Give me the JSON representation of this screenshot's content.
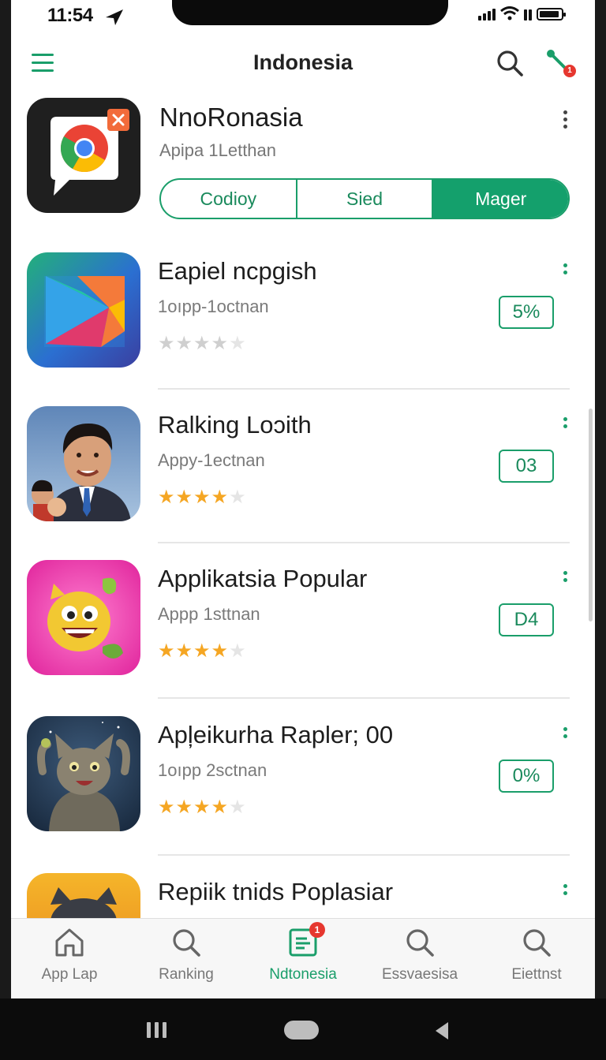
{
  "status_bar": {
    "time": "11:54"
  },
  "header": {
    "title": "Indonesia",
    "notification_count": "1"
  },
  "featured": {
    "name": "NnoRonasia",
    "subtitle": "Apipa 1Letthan",
    "segments": [
      "Codioy",
      "Sied",
      "Mager"
    ],
    "selected_segment": "Mager"
  },
  "apps": [
    {
      "name": "Eapiel ncpgish",
      "subtitle": "1oıpp-1octnan",
      "rating": 0,
      "badge": "5%",
      "icon": "play-store-icon"
    },
    {
      "name": "Ralking Loɔith",
      "subtitle": "Appy-1ectnan",
      "rating": 4,
      "badge": "03",
      "icon": "man-portrait-icon"
    },
    {
      "name": "Applikatsia Popular",
      "subtitle": "Appp 1sttnan",
      "rating": 4,
      "badge": "D4",
      "icon": "emoji-face-icon"
    },
    {
      "name": "Apļeikurha Rapler; 00",
      "subtitle": "1oıpp 2sctnan",
      "rating": 4,
      "badge": "0%",
      "icon": "cat-icon"
    },
    {
      "name": "Repiik tnids Poplasiar",
      "subtitle": "",
      "rating": 0,
      "badge": "",
      "icon": "cat-icon"
    }
  ],
  "tabs": [
    {
      "label": "App Lap",
      "icon": "home-icon"
    },
    {
      "label": "Ranking",
      "icon": "search-icon"
    },
    {
      "label": "Ndtonesia",
      "icon": "list-icon",
      "badge": "1"
    },
    {
      "label": "Essvaesisa",
      "icon": "search-icon"
    },
    {
      "label": "Eiettnst",
      "icon": "search-icon"
    }
  ],
  "active_tab": "Ndtonesia",
  "colors": {
    "accent": "#1a9e6a",
    "star": "#f5a623",
    "star_empty": "#cfcfcf",
    "badge_red": "#e6372f"
  }
}
